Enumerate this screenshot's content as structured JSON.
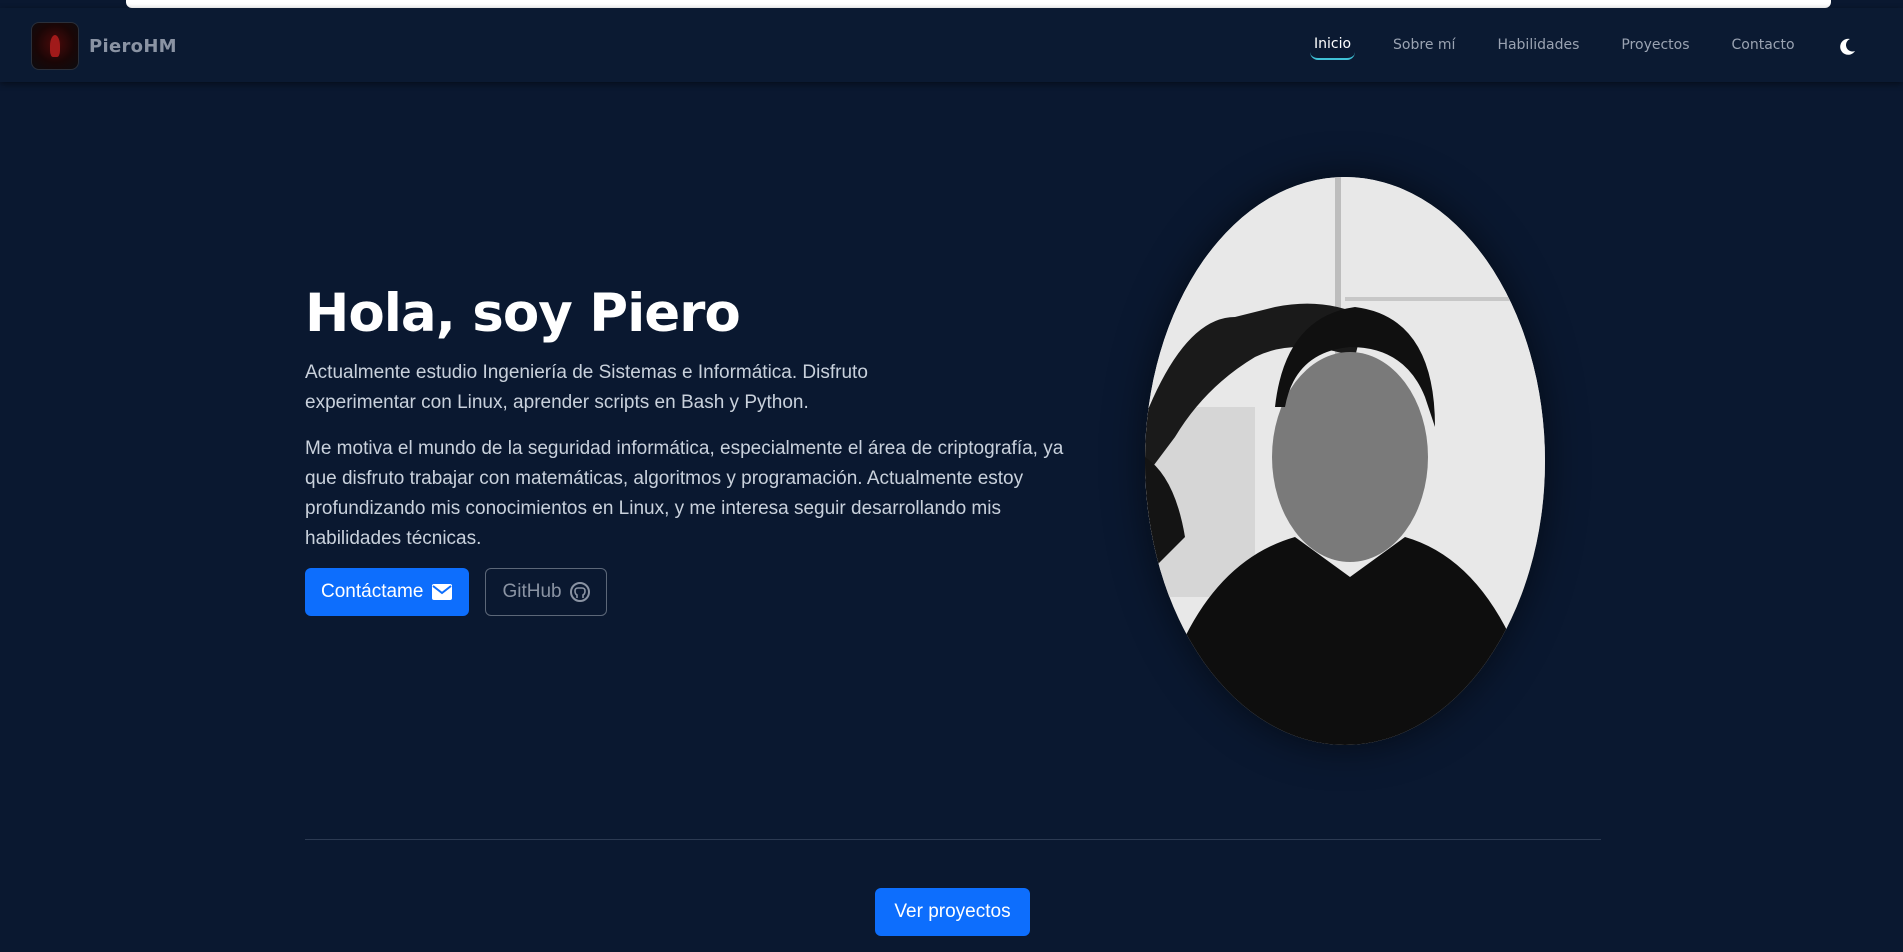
{
  "brand": {
    "name": "PieroHM",
    "logo_icon": "hooded-figure-icon"
  },
  "nav": {
    "items": [
      {
        "label": "Inicio",
        "active": true
      },
      {
        "label": "Sobre mí",
        "active": false
      },
      {
        "label": "Habilidades",
        "active": false
      },
      {
        "label": "Proyectos",
        "active": false
      },
      {
        "label": "Contacto",
        "active": false
      }
    ],
    "theme_toggle_icon": "moon-icon"
  },
  "hero": {
    "title": "Hola, soy Piero",
    "paragraph_1": "Actualmente estudio Ingeniería de Sistemas e Informática. Disfruto experimentar con Linux, aprender scripts en Bash y Python.",
    "paragraph_2": "Me motiva el mundo de la seguridad informática, especialmente el área de criptografía, ya que disfruto trabajar con matemáticas, algoritmos y programación. Actualmente estoy profundizando mis conocimientos en Linux, y me interesa seguir desarrollando mis habilidades técnicas.",
    "contact_button": {
      "label": "Contáctame",
      "icon": "envelope-icon"
    },
    "github_button": {
      "label": "GitHub",
      "icon": "github-icon"
    },
    "portrait_alt": "profile-photo"
  },
  "footer_cta": {
    "label": "Ver proyectos"
  },
  "colors": {
    "background": "#0a1830",
    "navbar": "#0b1a32",
    "primary": "#0d6efd",
    "active_underline": "#3fc1d6",
    "text_muted": "#9aa3b2"
  }
}
